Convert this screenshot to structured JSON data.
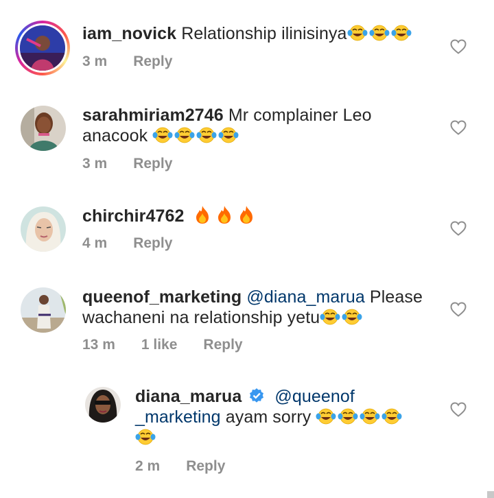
{
  "comments": [
    {
      "username": "iam_novick",
      "body": " Relationship ilinisinya",
      "emoji_laugh": 3,
      "time": "3 m",
      "reply": "Reply"
    },
    {
      "username": "sarahmiriam2746",
      "body_line1": " Mr complainer Leo",
      "body_line2": "anacook ",
      "emoji_laugh": 4,
      "time": "3 m",
      "reply": "Reply"
    },
    {
      "username": "chirchir4762",
      "emoji_fire": 3,
      "time": "4 m",
      "reply": "Reply"
    },
    {
      "username": "queenof_marketing",
      "mention": " @diana_marua",
      "body_line1": "  Please",
      "body_line2": "wachaneni na relationship yetu",
      "emoji_laugh": 2,
      "time": "13 m",
      "likes": "1 like",
      "reply": "Reply"
    },
    {
      "username": "diana_marua",
      "verified": true,
      "mention_line1": "@queenof",
      "mention_line2": "_marketing",
      "body": " ayam sorry ",
      "emoji_laugh": 5,
      "time": "2 m",
      "reply": "Reply"
    }
  ],
  "icons": {
    "like": "heart-outline-icon",
    "laugh": "face-with-tears-of-joy",
    "fire": "fire",
    "verified": "verified-badge-icon"
  },
  "colors": {
    "text": "#262626",
    "meta": "#8e8e8e",
    "mention": "#00376b",
    "verified": "#3897f0"
  }
}
